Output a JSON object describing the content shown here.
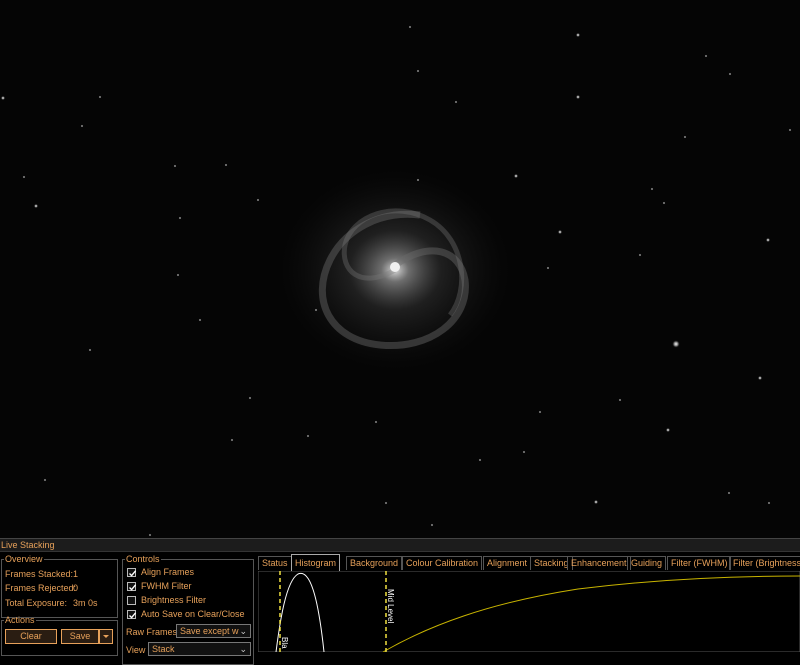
{
  "window": {
    "title": "Live Stacking"
  },
  "overview": {
    "legend": "Overview",
    "frames_stacked_label": "Frames Stacked:",
    "frames_stacked_value": "1",
    "frames_rejected_label": "Frames Rejected:",
    "frames_rejected_value": "0",
    "total_exposure_label": "Total Exposure:",
    "total_exposure_value": "3m 0s"
  },
  "actions": {
    "legend": "Actions",
    "clear_label": "Clear",
    "save_label": "Save",
    "save_dropdown_icon": "chevron-down-icon"
  },
  "controls": {
    "legend": "Controls",
    "checkboxes": [
      {
        "label": "Align Frames",
        "checked": true
      },
      {
        "label": "FWHM Filter",
        "checked": true
      },
      {
        "label": "Brightness Filter",
        "checked": false
      },
      {
        "label": "Auto Save on Clear/Close",
        "checked": true
      }
    ],
    "raw_frames_label": "Raw Frames",
    "raw_frames_value": "Save except w",
    "view_label": "View",
    "view_value": "Stack"
  },
  "tabs": [
    {
      "label": "Status",
      "active": false
    },
    {
      "label": "Histogram",
      "active": true
    },
    {
      "label": "Background",
      "active": false
    },
    {
      "label": "Colour Calibration",
      "active": false
    },
    {
      "label": "Alignment",
      "active": false
    },
    {
      "label": "Stacking",
      "active": false
    },
    {
      "label": "Enhancement",
      "active": false
    },
    {
      "label": "Guiding",
      "active": false
    },
    {
      "label": "Filter (FWHM)",
      "active": false
    },
    {
      "label": "Filter (Brightness",
      "active": false
    }
  ],
  "histogram": {
    "black_level_label": "Bla",
    "mid_level_label": "Mid Level",
    "curve_color": "#ffffff",
    "stretch_color": "#c8b400",
    "marker_color": "#f0e040"
  },
  "colors": {
    "accent": "#e7a15a",
    "background": "#000000"
  }
}
